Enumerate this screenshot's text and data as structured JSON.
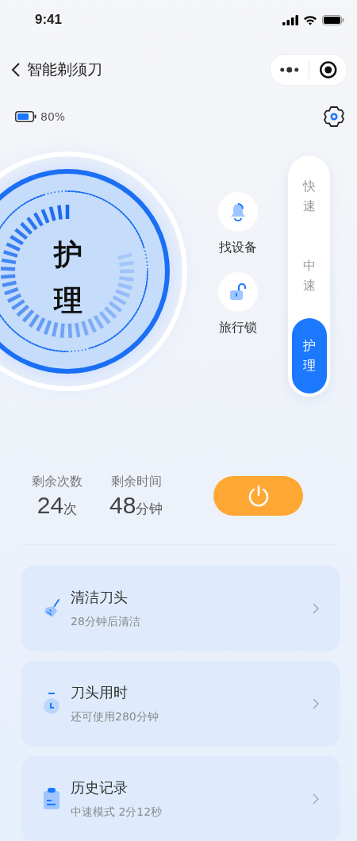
{
  "status_bar": {
    "time": "9:41"
  },
  "nav": {
    "title": "智能剃须刀"
  },
  "device": {
    "battery_reading": "80%"
  },
  "dial": {
    "mode_label": "护理"
  },
  "actions": [
    {
      "kind": "bell",
      "label": "找设备"
    },
    {
      "kind": "lock",
      "label": "旅行锁"
    }
  ],
  "modes": [
    {
      "label": "快速",
      "selected": false
    },
    {
      "label": "中速",
      "selected": false
    },
    {
      "label": "护理",
      "selected": true
    }
  ],
  "stats": [
    {
      "label": "剩余次数",
      "value": "24",
      "unit": "次"
    },
    {
      "label": "剩余时间",
      "value": "48",
      "unit": "分钟"
    }
  ],
  "cards": [
    {
      "kind": "broom",
      "title": "清洁刀头",
      "subtitle": "28分钟后清洁"
    },
    {
      "kind": "timer",
      "title": "刀头用时",
      "subtitle": "还可使用280分钟"
    },
    {
      "kind": "clipboard",
      "title": "历史记录",
      "subtitle": "中速模式 2分12秒"
    }
  ]
}
